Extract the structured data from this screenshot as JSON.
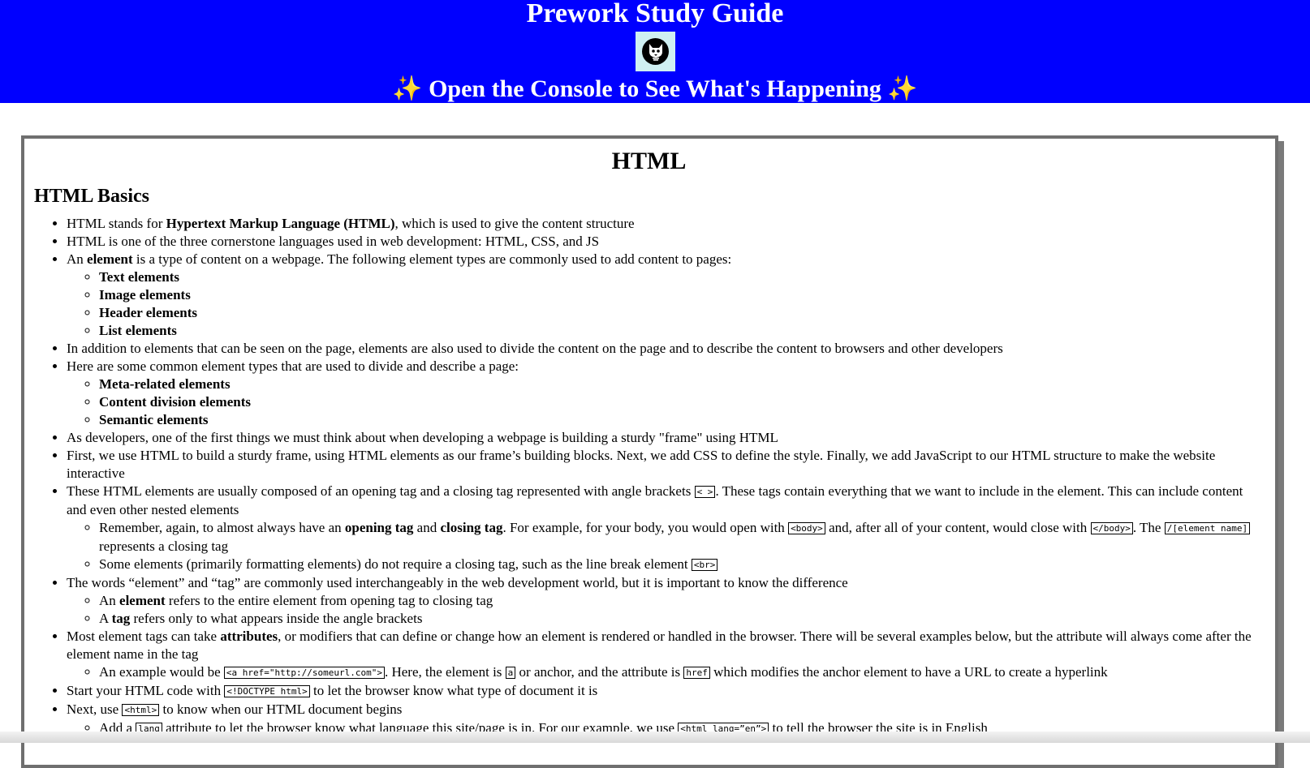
{
  "header": {
    "title": "Prework Study Guide",
    "subtitle_text": "Open the Console to See What's Happening",
    "sparkle": "✨",
    "background": "#0000ff"
  },
  "card": {
    "heading": "HTML",
    "section": "HTML Basics"
  },
  "content": {
    "b1": {
      "pre": "HTML stands for ",
      "bold": "Hypertext Markup Language (HTML)",
      "post": ", which is used to give the content structure"
    },
    "b2": "HTML is one of the three cornerstone languages used in web development: HTML, CSS, and JS",
    "b3": {
      "pre": "An ",
      "bold": "element",
      "post": " is a type of content on a webpage. The following element types are commonly used to add content to pages:"
    },
    "b3_sub": [
      "Text elements",
      "Image elements",
      "Header elements",
      "List elements"
    ],
    "b4": "In addition to elements that can be seen on the page, elements are also used to divide the content on the page and to describe the content to browsers and other developers",
    "b5": "Here are some common element types that are used to divide and describe a page:",
    "b5_sub": [
      "Meta-related elements",
      "Content division elements",
      "Semantic elements"
    ],
    "b6": "As developers, one of the first things we must think about when developing a webpage is building a sturdy \"frame\" using HTML",
    "b7": "First, we use HTML to build a sturdy frame, using HTML elements as our frame’s building blocks. Next, we add CSS to define the style. Finally, we add JavaScript to our HTML structure to make the website interactive",
    "b8": {
      "pre": "These HTML elements are usually composed of an opening tag and a closing tag represented with angle brackets ",
      "code": "< >",
      "post": ". These tags contain everything that we want to include in the element. This can include content and even other nested elements"
    },
    "b8_s1": {
      "t1": "Remember, again, to almost always have an ",
      "b1": "opening tag",
      "t2": " and ",
      "b2": "closing tag",
      "t3": ". For example, for your body, you would open with ",
      "c1": "<body>",
      "t4": " and, after all of your content, would close with ",
      "c2": "</body>",
      "t5": ". The ",
      "c3": "/[element name]",
      "t6": " represents a closing tag"
    },
    "b8_s2": {
      "pre": "Some elements (primarily formatting elements) do not require a closing tag, such as the line break element ",
      "code": "<br>"
    },
    "b9": "The words “element” and “tag” are commonly used interchangeably in the web development world, but it is important to know the difference",
    "b9_s1": {
      "pre": "An ",
      "bold": "element",
      "post": " refers to the entire element from opening tag to closing tag"
    },
    "b9_s2": {
      "pre": "A ",
      "bold": "tag",
      "post": " refers only to what appears inside the angle brackets"
    },
    "b10": {
      "pre": "Most element tags can take ",
      "bold": "attributes",
      "post": ", or modifiers that can define or change how an element is rendered or handled in the browser. There will be several examples below, but the attribute will always come after the element name in the tag"
    },
    "b10_s1": {
      "t1": "An example would be ",
      "c1": "<a href=\"http://someurl.com\">",
      "t2": ". Here, the element is ",
      "c2": "a",
      "t3": " or anchor, and the attribute is ",
      "c3": "href",
      "t4": " which modifies the anchor element to have a URL to create a hyperlink"
    },
    "b11": {
      "pre": "Start your HTML code with ",
      "code": "<!DOCTYPE html>",
      "post": " to let the browser know what type of document it is"
    },
    "b12": {
      "pre": "Next, use ",
      "code": "<html>",
      "post": " to know when our HTML document begins"
    },
    "b12_s1": {
      "t1": "Add a ",
      "c1": "lang",
      "t2": " attribute to let the browser know what language this site/page is in. For our example, we use ",
      "c2": "<html lang=”en”>",
      "t3": " to tell the browser the site is in English"
    }
  }
}
